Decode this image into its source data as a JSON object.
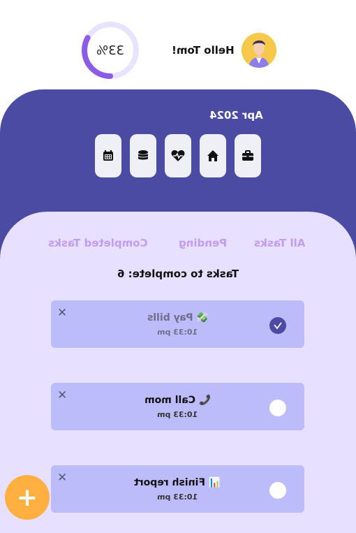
{
  "header": {
    "progress": {
      "value": 33,
      "label": "33%"
    },
    "greeting": "Hello Tom!"
  },
  "calendar": {
    "month": "Apr 2024"
  },
  "categories": [
    {
      "name": "calendar",
      "icon": "calendar-icon"
    },
    {
      "name": "finance",
      "icon": "coins-icon"
    },
    {
      "name": "health",
      "icon": "heart-pulse-icon"
    },
    {
      "name": "home",
      "icon": "home-icon"
    },
    {
      "name": "work",
      "icon": "briefcase-icon"
    }
  ],
  "filters": {
    "completed": "Completed Tasks",
    "pending": "Pending",
    "all": "All Tasks"
  },
  "tasks_count_label": "Tasks to complete: 6",
  "tasks": [
    {
      "emoji": "💸",
      "title": "Pay bills",
      "time": "10:33 pm",
      "done": true
    },
    {
      "emoji": "📞",
      "title": "Call mom",
      "time": "10:33 pm",
      "done": false
    },
    {
      "emoji": "📊",
      "title": "Finish report",
      "time": "10:33 pm",
      "done": false
    }
  ],
  "colors": {
    "primary": "#4b4ba3",
    "panel": "#e8e0ff",
    "card": "#bdbcfb",
    "accent": "#ffb041",
    "tab": "#c29cf0"
  },
  "fab": {
    "label": "+"
  }
}
